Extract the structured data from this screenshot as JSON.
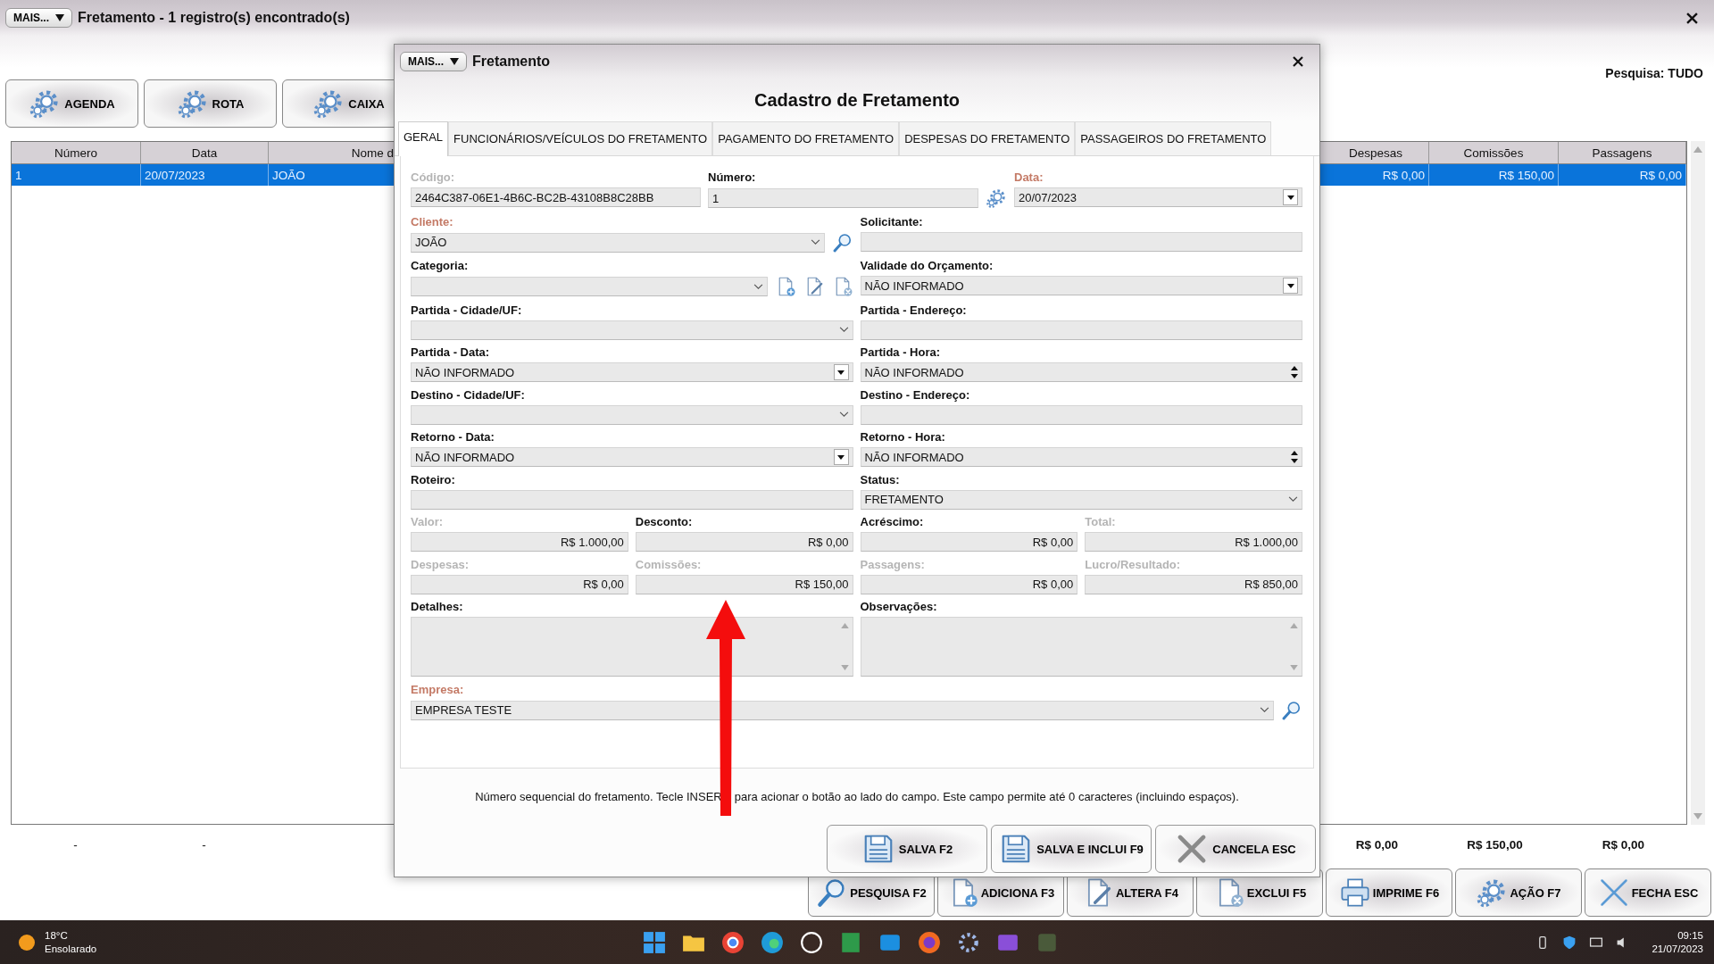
{
  "window": {
    "menu_button": "MAIS...",
    "title": "Fretamento - 1 registro(s) encontrado(s)"
  },
  "toolbar": [
    "AGENDA",
    "ROTA",
    "CAIXA"
  ],
  "search_scope": "Pesquisa: TUDO",
  "table": {
    "columns": [
      "Número",
      "Data",
      "Nome d",
      "Despesas",
      "Comissões",
      "Passagens"
    ],
    "rows": [
      {
        "selected": true,
        "cells": [
          "1",
          "20/07/2023",
          "JOÃO",
          "R$ 0,00",
          "R$ 150,00",
          "R$ 0,00"
        ]
      }
    ],
    "totals_left": [
      "-",
      "-"
    ],
    "totals_right": [
      "R$ 0,00",
      "R$ 150,00",
      "R$ 0,00"
    ]
  },
  "actions": [
    "PESQUISA F2",
    "ADICIONA F3",
    "ALTERA F4",
    "EXCLUI F5",
    "IMPRIME F6",
    "AÇÃO F7",
    "FECHA ESC"
  ],
  "dialog": {
    "menu_button": "MAIS...",
    "title": "Fretamento",
    "heading": "Cadastro de Fretamento",
    "tabs": [
      {
        "label": "GERAL",
        "selected": true
      },
      {
        "label": "FUNCIONÁRIOS/VEÍCULOS DO FRETAMENTO",
        "selected": false
      },
      {
        "label": "PAGAMENTO DO FRETAMENTO",
        "selected": false
      },
      {
        "label": "DESPESAS DO FRETAMENTO",
        "selected": false
      },
      {
        "label": "PASSAGEIROS DO FRETAMENTO",
        "selected": false
      }
    ],
    "rows": [
      [
        {
          "label": "Código:",
          "kind": "text",
          "value": "2464C387-06E1-4B6C-BC2B-43108B8C28BB",
          "required": false,
          "disabled": true
        },
        {
          "label": "Número:",
          "kind": "text",
          "value": "1",
          "required": false,
          "disabled": false
        },
        {
          "label": "Data:",
          "kind": "dropdown",
          "value": "20/07/2023",
          "required": true
        }
      ],
      [
        {
          "label": "Cliente:",
          "kind": "combo",
          "value": "JOÃO",
          "required": true
        },
        {
          "label": "Solicitante:",
          "kind": "text",
          "required": false,
          "disabled": false
        }
      ],
      [
        {
          "label": "Categoria:",
          "kind": "combo",
          "required": false,
          "disabled": false
        },
        {
          "label": "Validade do Orçamento:",
          "kind": "dropdown",
          "value": "NÃO INFORMADO",
          "required": false,
          "disabled": false
        }
      ],
      [
        {
          "label": "Partida - Cidade/UF:",
          "kind": "combo",
          "required": false,
          "disabled": false
        },
        {
          "label": "Partida - Endereço:",
          "kind": "text",
          "required": false,
          "disabled": false
        }
      ],
      [
        {
          "label": "Partida - Data:",
          "kind": "dropdown",
          "value": "NÃO INFORMADO",
          "required": false,
          "disabled": false
        },
        {
          "label": "Partida - Hora:",
          "kind": "spinner",
          "value": "NÃO INFORMADO",
          "required": false,
          "disabled": false
        }
      ],
      [
        {
          "label": "Destino - Cidade/UF:",
          "kind": "combo",
          "required": false,
          "disabled": false
        },
        {
          "label": "Destino - Endereço:",
          "kind": "text",
          "required": false,
          "disabled": false
        }
      ],
      [
        {
          "label": "Retorno - Data:",
          "kind": "dropdown",
          "value": "NÃO INFORMADO",
          "required": false,
          "disabled": false
        },
        {
          "label": "Retorno - Hora:",
          "kind": "spinner",
          "value": "NÃO INFORMADO",
          "required": false,
          "disabled": false
        }
      ],
      [
        {
          "label": "Roteiro:",
          "kind": "text",
          "required": false,
          "disabled": false
        },
        {
          "label": "Status:",
          "kind": "combo",
          "value": "FRETAMENTO",
          "required": false,
          "disabled": false
        }
      ],
      [
        {
          "label": "Valor:",
          "kind": "money",
          "value": "R$ 1.000,00",
          "required": false,
          "disabled": true
        },
        {
          "label": "Desconto:",
          "kind": "money",
          "value": "R$ 0,00",
          "required": false,
          "disabled": false
        },
        {
          "label": "Acréscimo:",
          "kind": "money",
          "value": "R$ 0,00",
          "required": false,
          "disabled": false
        },
        {
          "label": "Total:",
          "kind": "money",
          "value": "R$ 1.000,00",
          "required": false,
          "disabled": true
        }
      ],
      [
        {
          "label": "Despesas:",
          "kind": "money",
          "value": "R$ 0,00",
          "required": false,
          "disabled": true
        },
        {
          "label": "Comissões:",
          "kind": "money",
          "value": "R$ 150,00",
          "required": false,
          "disabled": true
        },
        {
          "label": "Passagens:",
          "kind": "money",
          "value": "R$ 0,00",
          "required": false,
          "disabled": true
        },
        {
          "label": "Lucro/Resultado:",
          "kind": "money",
          "value": "R$ 850,00",
          "required": false,
          "disabled": true
        }
      ],
      [
        {
          "label": "Detalhes:",
          "kind": "memo",
          "required": false,
          "disabled": false
        },
        {
          "label": "Observações:",
          "kind": "memo",
          "required": false,
          "disabled": false
        }
      ],
      [
        {
          "label": "Empresa:",
          "kind": "combo",
          "value": "EMPRESA TESTE",
          "required": true
        }
      ]
    ],
    "hint_before": "Número sequencial do fretamento. Tecle INSER",
    "hint_after": "para acionar o botão ao lado do campo. Este campo permite até 0 caracteres (incluindo espaços).",
    "buttons": [
      "SALVA F2",
      "SALVA E INCLUI F9",
      "CANCELA ESC"
    ]
  },
  "taskbar": {
    "temperature": "18°C",
    "weather": "Ensolarado",
    "time": "09:15",
    "date": "21/07/2023"
  }
}
